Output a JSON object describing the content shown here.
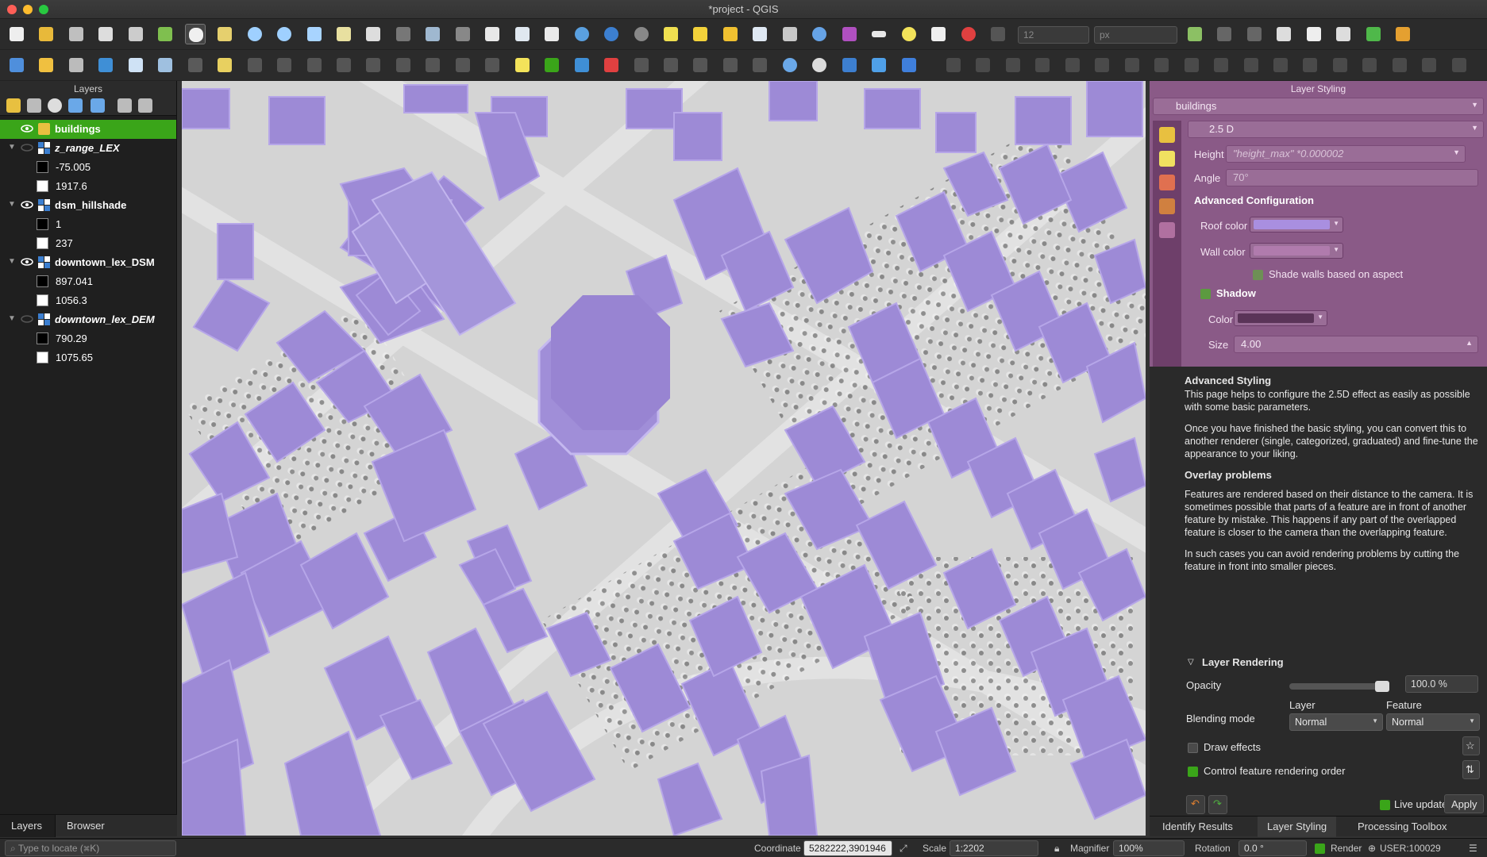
{
  "window": {
    "title": "*project - QGIS"
  },
  "toolbar": {
    "font_size_value": "12",
    "font_unit_value": "px"
  },
  "layers_panel": {
    "title": "Layers",
    "layers": [
      {
        "name": "buildings",
        "visible": true,
        "selected": true
      },
      {
        "name": "z_range_LEX",
        "visible": false,
        "italic": true,
        "legend": [
          {
            "label": "-75.005",
            "color": "#000000"
          },
          {
            "label": "1917.6",
            "color": "#ffffff"
          }
        ]
      },
      {
        "name": "dsm_hillshade",
        "visible": true,
        "legend": [
          {
            "label": "1",
            "color": "#000000"
          },
          {
            "label": "237",
            "color": "#ffffff"
          }
        ]
      },
      {
        "name": "downtown_lex_DSM",
        "visible": true,
        "legend": [
          {
            "label": "897.041",
            "color": "#000000"
          },
          {
            "label": "1056.3",
            "color": "#ffffff"
          }
        ]
      },
      {
        "name": "downtown_lex_DEM",
        "visible": false,
        "italic": true,
        "legend": [
          {
            "label": "790.29",
            "color": "#000000"
          },
          {
            "label": "1075.65",
            "color": "#ffffff"
          }
        ]
      }
    ],
    "tabs": [
      "Layers",
      "Browser"
    ]
  },
  "layer_styling": {
    "title": "Layer Styling",
    "layer_combo": "buildings",
    "renderer_combo": "2.5 D",
    "height_label": "Height",
    "height_value": "\"height_max\" *0.000002",
    "angle_label": "Angle",
    "angle_value": "70°",
    "advanced_config_title": "Advanced Configuration",
    "roof_color_label": "Roof color",
    "roof_color": "#a98fe0",
    "wall_color_label": "Wall color",
    "wall_color": "#b77fb3",
    "shade_walls_label": "Shade walls based on aspect",
    "shadow_label": "Shadow",
    "shadow_color_label": "Color",
    "shadow_color": "#5a3458",
    "size_label": "Size",
    "size_value": "4.00",
    "help": {
      "h1": "Advanced Styling",
      "p1": "This page helps to configure the 2.5D effect as easily as possible with some basic parameters.",
      "p2": "Once you have finished the basic styling, you can convert this to another renderer (single, categorized, graduated) and fine-tune the appearance to your liking.",
      "h2": "Overlay problems",
      "p3": "Features are rendered based on their distance to the camera. It is sometimes possible that parts of a feature are in front of another feature by mistake. This happens if any part of the overlapped feature is closer to the camera than the overlapping feature.",
      "p4": "In such cases you can avoid rendering problems by cutting the feature in front into smaller pieces."
    },
    "layer_rendering_title": "Layer Rendering",
    "opacity_label": "Opacity",
    "opacity_value": "100.0 %",
    "blending_label": "Blending mode",
    "blend_layer_label": "Layer",
    "blend_feature_label": "Feature",
    "blend_layer_value": "Normal",
    "blend_feature_value": "Normal",
    "draw_effects_label": "Draw effects",
    "control_order_label": "Control feature rendering order",
    "live_update_label": "Live update",
    "apply_label": "Apply",
    "tabs": [
      "Identify Results",
      "Layer Styling",
      "Processing Toolbox"
    ]
  },
  "statusbar": {
    "locate_placeholder": "Type to locate (⌘K)",
    "coordinate_label": "Coordinate",
    "coordinate_value": "5282222,3901946",
    "scale_label": "Scale",
    "scale_value": "1:2202",
    "magnifier_label": "Magnifier",
    "magnifier_value": "100%",
    "rotation_label": "Rotation",
    "rotation_value": "0.0 °",
    "render_label": "Render",
    "crs_label": "USER:100029"
  },
  "colors": {
    "building_fill": "#9d8ad6",
    "building_wall": "#b6a6e8",
    "selected_row": "#3aa519",
    "styling_panel": "#8a5a87"
  }
}
